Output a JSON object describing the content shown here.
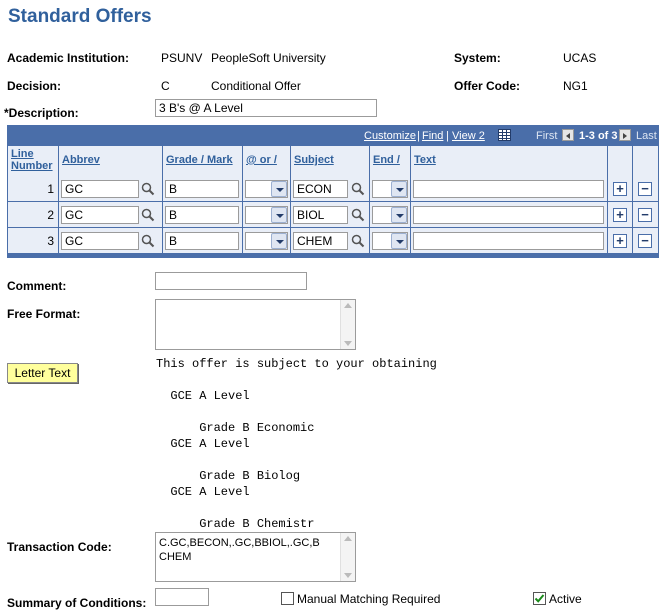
{
  "page": {
    "title": "Standard Offers"
  },
  "header": {
    "institution_label": "Academic Institution:",
    "institution_code": "PSUNV",
    "institution_name": "PeopleSoft University",
    "system_label": "System:",
    "system_value": "UCAS",
    "decision_label": "Decision:",
    "decision_code": "C",
    "decision_name": "Conditional Offer",
    "offer_code_label": "Offer Code:",
    "offer_code_value": "NG1",
    "description_label": "*Description:",
    "description_value": "3 B's @ A Level"
  },
  "grid": {
    "nav": {
      "customize": "Customize",
      "sep1": "|",
      "find": "Find",
      "sep2": "|",
      "view": "View 2",
      "first": "First",
      "range": "1-3 of 3",
      "last": "Last"
    },
    "columns": {
      "line_number_1": "Line",
      "line_number_2": "Number",
      "abbrev": "Abbrev",
      "grade": "Grade / Mark",
      "at_or": "@ or /",
      "subject": "Subject",
      "end": "End /",
      "text": "Text"
    },
    "rows": [
      {
        "line": "1",
        "abbrev": "GC",
        "grade": "B",
        "at_or": "",
        "subject": "ECON",
        "end": "",
        "text": ""
      },
      {
        "line": "2",
        "abbrev": "GC",
        "grade": "B",
        "at_or": "",
        "subject": "BIOL",
        "end": "",
        "text": ""
      },
      {
        "line": "3",
        "abbrev": "GC",
        "grade": "B",
        "at_or": "",
        "subject": "CHEM",
        "end": "",
        "text": ""
      }
    ]
  },
  "form": {
    "comment_label": "Comment:",
    "comment_value": "",
    "free_format_label": "Free Format:",
    "free_format_value": "",
    "letter_text_button": "Letter Text",
    "letter_text_lines": [
      "This offer is subject to your obtaining",
      "",
      "  GCE A Level",
      "",
      "      Grade B Economic",
      "  GCE A Level",
      "",
      "      Grade B Biolog",
      "  GCE A Level",
      "",
      "      Grade B Chemistr"
    ],
    "transaction_code_label": "Transaction Code:",
    "transaction_code_line1": "C.GC,BECON,.GC,BBIOL,.GC,B",
    "transaction_code_line2": "CHEM",
    "summary_label": "Summary of Conditions:",
    "summary_value": "",
    "manual_matching_label": "Manual Matching Required",
    "manual_matching_checked": false,
    "active_label": "Active",
    "active_checked": true
  },
  "colors": {
    "title": "#30609c",
    "grid_border": "#4a6ea9",
    "grid_row": "#e9eef7",
    "button": "#ffff9c"
  }
}
